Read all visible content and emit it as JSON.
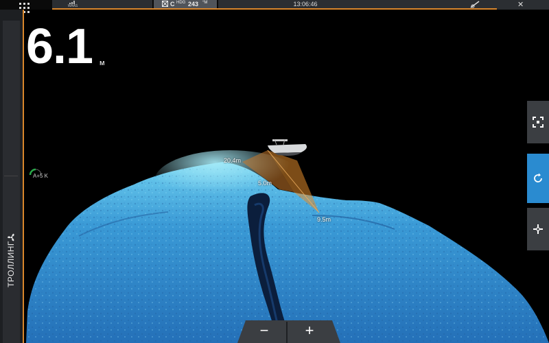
{
  "statusbar": {
    "gps_label": "WAAS",
    "heading_prefix": "C",
    "heading_label": "HDG",
    "heading_value": "243",
    "heading_unit": "°M",
    "time": "13:06:46"
  },
  "sidebar": {
    "mode_label": "ТРОЛЛИНГ",
    "mode_icon": "fan-icon"
  },
  "main": {
    "depth_value": "6.1",
    "depth_unit": "м",
    "gauge_text": "A+5  K",
    "range_labels": {
      "far": "20.4m",
      "mid": "5.0m",
      "near": "9.5m"
    }
  },
  "right_panel": {
    "items": [
      {
        "icon": "frame-icon",
        "active": false
      },
      {
        "icon": "rotate-icon",
        "active": true
      },
      {
        "icon": "move-icon",
        "active": false
      }
    ]
  },
  "zoom": {
    "minus_label": "−",
    "plus_label": "+"
  },
  "colors": {
    "accent": "#d9862b",
    "active_button": "#2a8bd0",
    "water": "#2f86c4"
  }
}
